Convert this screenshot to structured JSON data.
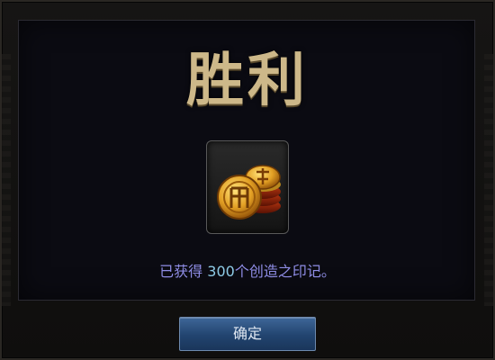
{
  "dialog": {
    "title": "胜利",
    "reward_icon": "creation-mark-coins-icon",
    "message_prefix": "已获得 ",
    "message_amount": "300",
    "message_suffix": "个创造之印记。",
    "confirm_label": "确定"
  },
  "colors": {
    "title": "#cdb889",
    "message": "#8f8de6",
    "amount": "#8ecbe6",
    "button": "#2c5283"
  }
}
